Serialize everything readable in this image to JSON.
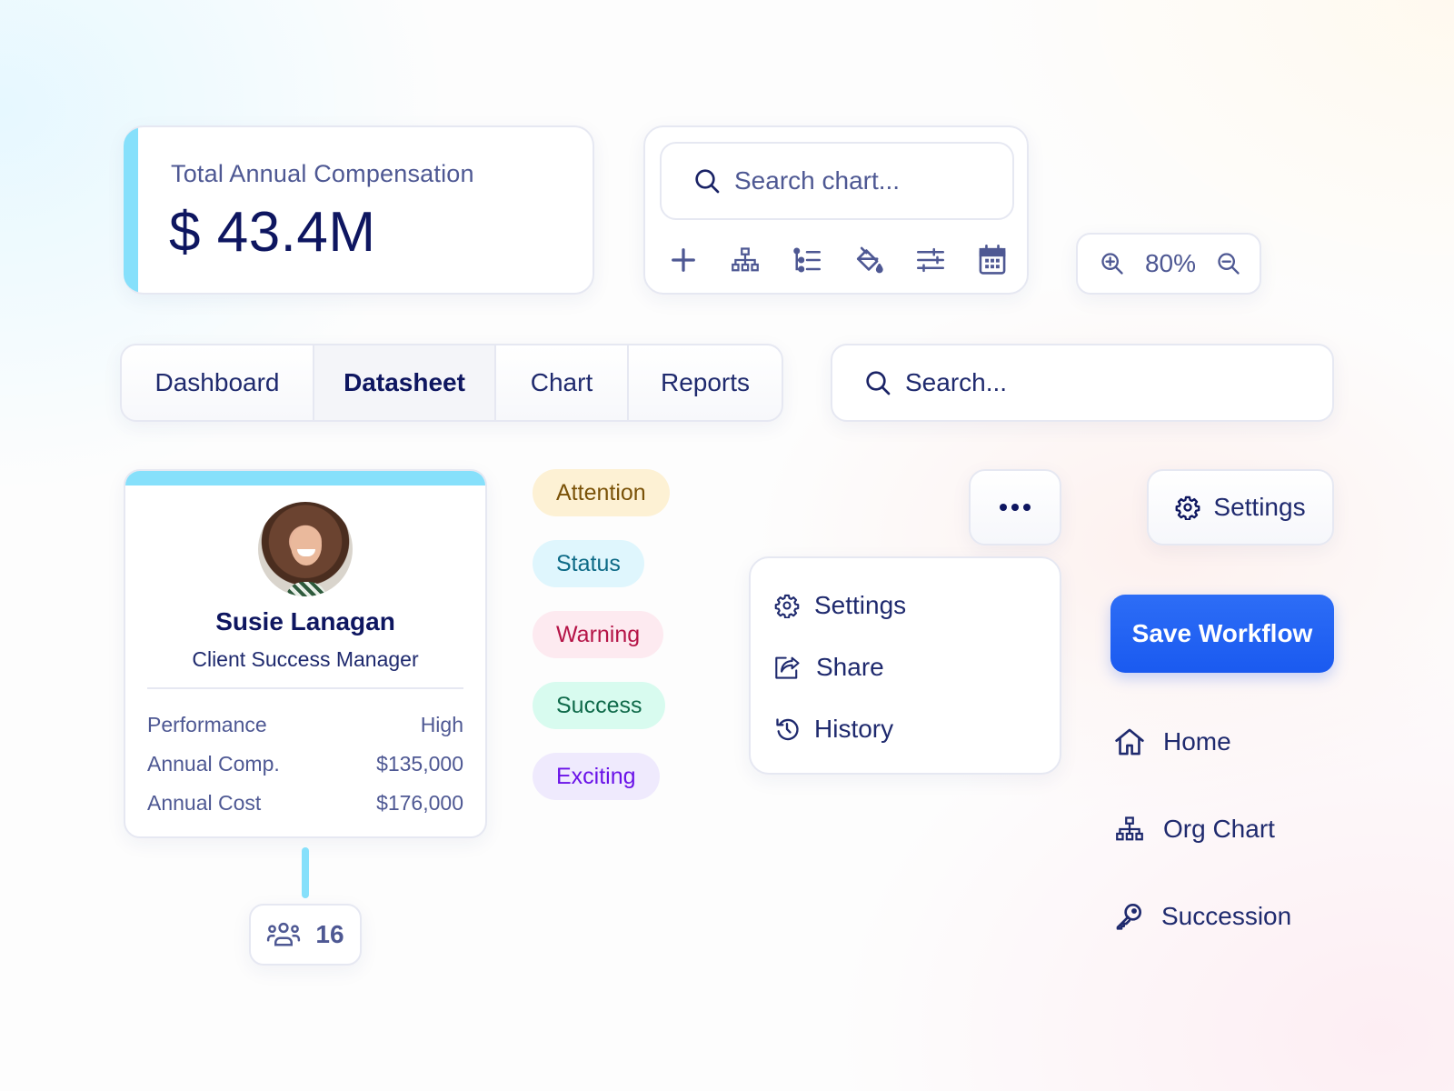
{
  "compensation_card": {
    "label": "Total Annual Compensation",
    "value": "$ 43.4M",
    "accent_color": "#86e0fb"
  },
  "chart_toolbar": {
    "search_placeholder": "Search chart...",
    "tools": [
      {
        "name": "add",
        "icon": "plus-icon"
      },
      {
        "name": "org-structure",
        "icon": "org-chart-icon"
      },
      {
        "name": "hierarchy-list",
        "icon": "list-tree-icon"
      },
      {
        "name": "color-fill",
        "icon": "paint-bucket-icon"
      },
      {
        "name": "adjustments",
        "icon": "sliders-icon"
      },
      {
        "name": "calendar",
        "icon": "calendar-icon"
      }
    ]
  },
  "zoom_control": {
    "zoom_in_icon": "zoom-in-icon",
    "value": "80%",
    "zoom_out_icon": "zoom-out-icon"
  },
  "tabs": [
    {
      "label": "Dashboard",
      "active": false
    },
    {
      "label": "Datasheet",
      "active": true
    },
    {
      "label": "Chart",
      "active": false
    },
    {
      "label": "Reports",
      "active": false
    }
  ],
  "main_search": {
    "placeholder": "Search..."
  },
  "person_card": {
    "name": "Susie Lanagan",
    "role": "Client Success Manager",
    "rows": [
      {
        "label": "Performance",
        "value": "High"
      },
      {
        "label": "Annual Comp.",
        "value": "$135,000"
      },
      {
        "label": "Annual Cost",
        "value": "$176,000"
      }
    ],
    "team_count": "16"
  },
  "badges": [
    {
      "label": "Attention",
      "bg": "#fdf1d4",
      "fg": "#7a5208"
    },
    {
      "label": "Status",
      "bg": "#dff6fd",
      "fg": "#0d6a86"
    },
    {
      "label": "Warning",
      "bg": "#fdeaf0",
      "fg": "#b51447"
    },
    {
      "label": "Success",
      "bg": "#d8fbef",
      "fg": "#0f6a4a"
    },
    {
      "label": "Exciting",
      "bg": "#efeafd",
      "fg": "#6a12e8"
    }
  ],
  "more_button": {
    "icon": "more-horizontal-icon"
  },
  "dropdown_menu": {
    "items": [
      {
        "label": "Settings",
        "icon": "gear-icon"
      },
      {
        "label": "Share",
        "icon": "share-icon"
      },
      {
        "label": "History",
        "icon": "history-icon"
      }
    ]
  },
  "settings_button": {
    "label": "Settings"
  },
  "save_button": {
    "label": "Save Workflow",
    "color": "#1f5ff3"
  },
  "nav": [
    {
      "label": "Home",
      "icon": "home-icon"
    },
    {
      "label": "Org Chart",
      "icon": "org-chart-icon"
    },
    {
      "label": "Succession",
      "icon": "key-icon"
    }
  ]
}
